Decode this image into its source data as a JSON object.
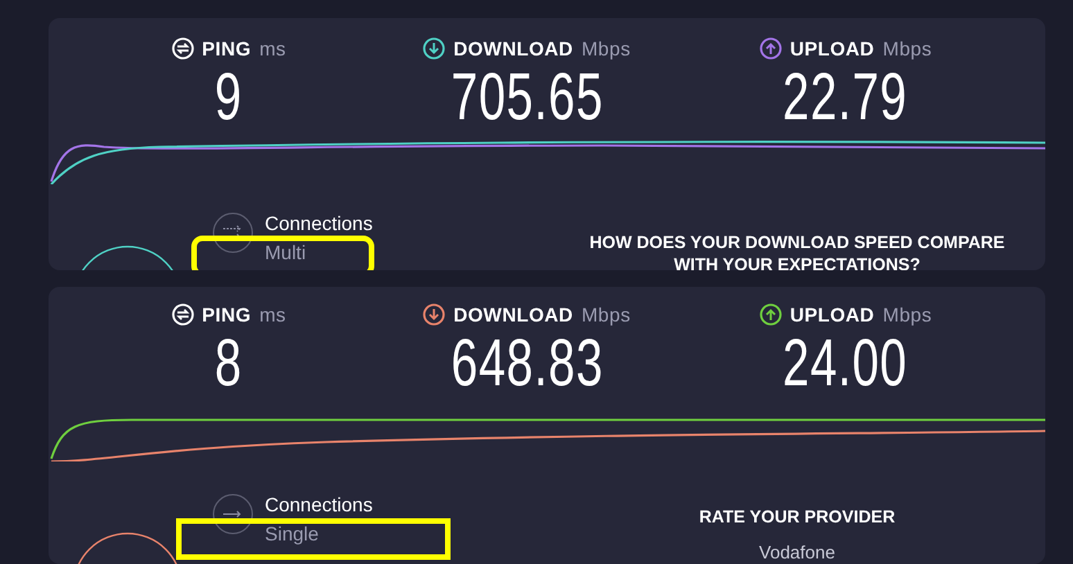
{
  "results": [
    {
      "metrics": [
        {
          "kind": "ping",
          "label": "PING",
          "unit": "ms",
          "value": "9"
        },
        {
          "kind": "download",
          "label": "DOWNLOAD",
          "unit": "Mbps",
          "value": "705.65",
          "color": "#4fd1c5"
        },
        {
          "kind": "upload",
          "label": "UPLOAD",
          "unit": "Mbps",
          "value": "22.79",
          "color": "#a374e8"
        }
      ],
      "connections": {
        "label": "Connections",
        "value": "Multi",
        "highlight": {
          "kind": "rounded"
        }
      },
      "side": {
        "heading": "HOW DOES YOUR DOWNLOAD SPEED COMPARE WITH YOUR EXPECTATIONS?"
      }
    },
    {
      "metrics": [
        {
          "kind": "ping",
          "label": "PING",
          "unit": "ms",
          "value": "8"
        },
        {
          "kind": "download",
          "label": "DOWNLOAD",
          "unit": "Mbps",
          "value": "648.83",
          "color": "#e8836b"
        },
        {
          "kind": "upload",
          "label": "UPLOAD",
          "unit": "Mbps",
          "value": "24.00",
          "color": "#6fcf3f"
        }
      ],
      "connections": {
        "label": "Connections",
        "value": "Single",
        "highlight": {
          "kind": "square"
        }
      },
      "side": {
        "heading": "RATE YOUR PROVIDER",
        "provider": "Vodafone"
      }
    }
  ]
}
